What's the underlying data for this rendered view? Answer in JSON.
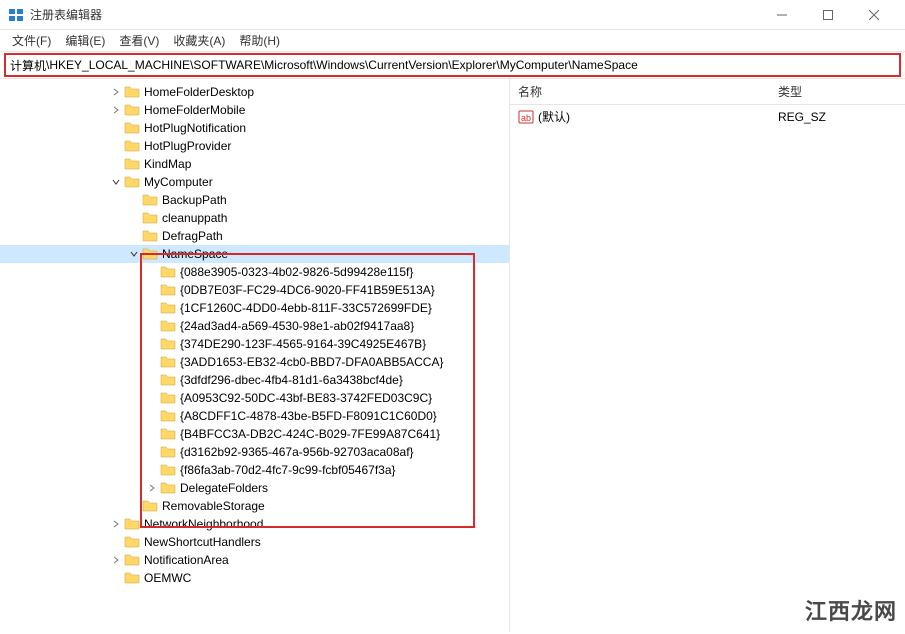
{
  "window": {
    "title": "注册表编辑器"
  },
  "menubar": [
    "文件(F)",
    "编辑(E)",
    "查看(V)",
    "收藏夹(A)",
    "帮助(H)"
  ],
  "address": {
    "label": "计算机",
    "path": "\\HKEY_LOCAL_MACHINE\\SOFTWARE\\Microsoft\\Windows\\CurrentVersion\\Explorer\\MyComputer\\NameSpace"
  },
  "right": {
    "headers": {
      "name": "名称",
      "type": "类型"
    },
    "rows": [
      {
        "name": "(默认)",
        "type": "REG_SZ",
        "icon": "string-value-icon"
      }
    ]
  },
  "watermark": "江西龙网",
  "tree": [
    {
      "depth": 6,
      "exp": "closed",
      "label": "HomeFolderDesktop"
    },
    {
      "depth": 6,
      "exp": "closed",
      "label": "HomeFolderMobile"
    },
    {
      "depth": 6,
      "exp": "none",
      "label": "HotPlugNotification"
    },
    {
      "depth": 6,
      "exp": "none",
      "label": "HotPlugProvider"
    },
    {
      "depth": 6,
      "exp": "none",
      "label": "KindMap"
    },
    {
      "depth": 6,
      "exp": "open",
      "label": "MyComputer"
    },
    {
      "depth": 7,
      "exp": "none",
      "label": "BackupPath"
    },
    {
      "depth": 7,
      "exp": "none",
      "label": "cleanuppath"
    },
    {
      "depth": 7,
      "exp": "none",
      "label": "DefragPath"
    },
    {
      "depth": 7,
      "exp": "open",
      "label": "NameSpace",
      "selected": true
    },
    {
      "depth": 8,
      "exp": "none",
      "label": "{088e3905-0323-4b02-9826-5d99428e115f}"
    },
    {
      "depth": 8,
      "exp": "none",
      "label": "{0DB7E03F-FC29-4DC6-9020-FF41B59E513A}"
    },
    {
      "depth": 8,
      "exp": "none",
      "label": "{1CF1260C-4DD0-4ebb-811F-33C572699FDE}"
    },
    {
      "depth": 8,
      "exp": "none",
      "label": "{24ad3ad4-a569-4530-98e1-ab02f9417aa8}"
    },
    {
      "depth": 8,
      "exp": "none",
      "label": "{374DE290-123F-4565-9164-39C4925E467B}"
    },
    {
      "depth": 8,
      "exp": "none",
      "label": "{3ADD1653-EB32-4cb0-BBD7-DFA0ABB5ACCA}"
    },
    {
      "depth": 8,
      "exp": "none",
      "label": "{3dfdf296-dbec-4fb4-81d1-6a3438bcf4de}"
    },
    {
      "depth": 8,
      "exp": "none",
      "label": "{A0953C92-50DC-43bf-BE83-3742FED03C9C}"
    },
    {
      "depth": 8,
      "exp": "none",
      "label": "{A8CDFF1C-4878-43be-B5FD-F8091C1C60D0}"
    },
    {
      "depth": 8,
      "exp": "none",
      "label": "{B4BFCC3A-DB2C-424C-B029-7FE99A87C641}"
    },
    {
      "depth": 8,
      "exp": "none",
      "label": "{d3162b92-9365-467a-956b-92703aca08af}"
    },
    {
      "depth": 8,
      "exp": "none",
      "label": "{f86fa3ab-70d2-4fc7-9c99-fcbf05467f3a}"
    },
    {
      "depth": 8,
      "exp": "closed",
      "label": "DelegateFolders"
    },
    {
      "depth": 7,
      "exp": "none",
      "label": "RemovableStorage"
    },
    {
      "depth": 6,
      "exp": "closed",
      "label": "NetworkNeighborhood"
    },
    {
      "depth": 6,
      "exp": "none",
      "label": "NewShortcutHandlers"
    },
    {
      "depth": 6,
      "exp": "closed",
      "label": "NotificationArea"
    },
    {
      "depth": 6,
      "exp": "none",
      "label": "OEMWC"
    }
  ]
}
